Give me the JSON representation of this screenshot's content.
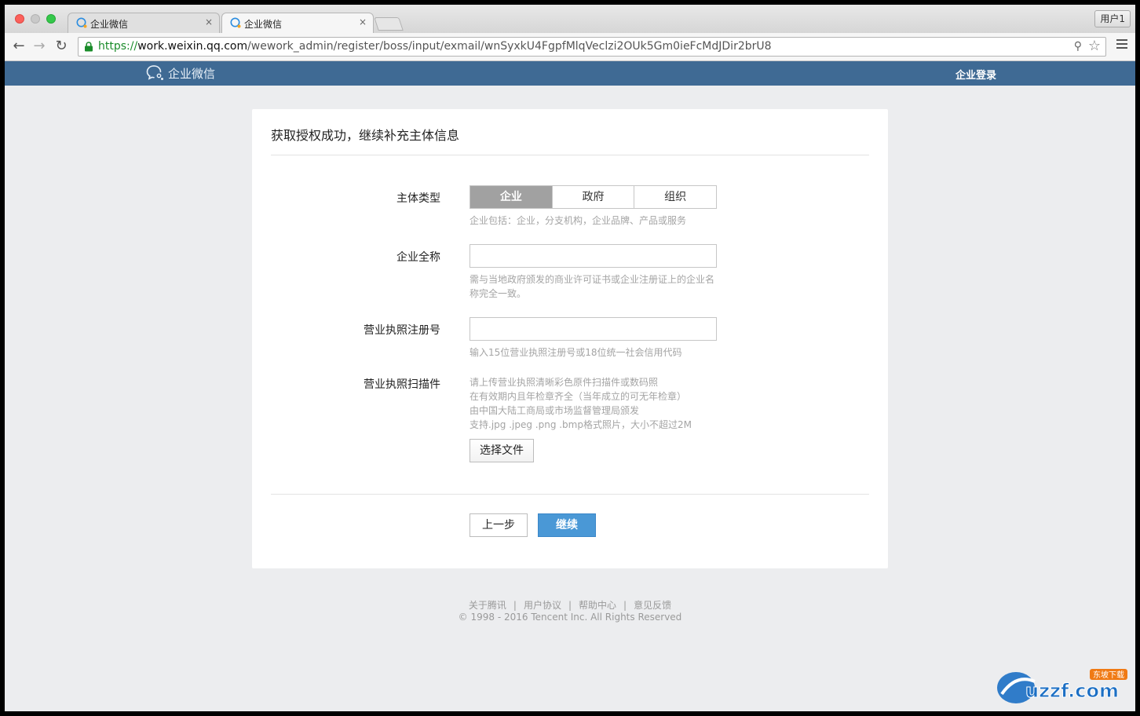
{
  "browser": {
    "tabs": [
      {
        "title": "企业微信",
        "close": "×"
      },
      {
        "title": "企业微信",
        "close": "×"
      }
    ],
    "profile_button": "用户1",
    "url": {
      "scheme": "https://",
      "host": "work.weixin.qq.com",
      "path": "/wework_admin/register/boss/input/exmail/wnSyxkU4FgpfMlqVeclzi2OUk5Gm0ieFcMdJDir2brU8"
    },
    "icons": {
      "back": "arrow-left-icon",
      "forward": "arrow-right-icon",
      "reload": "reload-icon",
      "lock": "lock-icon",
      "key": "key-icon",
      "star": "star-icon",
      "menu": "hamburger-menu-icon"
    }
  },
  "header": {
    "logo_text": "企业微信",
    "login_link": "企业登录",
    "bg_color": "#3f6a94"
  },
  "form": {
    "title": "获取授权成功，继续补充主体信息",
    "entity_type": {
      "label": "主体类型",
      "options": [
        "企业",
        "政府",
        "组织"
      ],
      "selected": "企业",
      "hint": "企业包括：企业，分支机构，企业品牌、产品或服务"
    },
    "full_name": {
      "label": "企业全称",
      "value": "",
      "hint": "需与当地政府颁发的商业许可证书或企业注册证上的企业名称完全一致。"
    },
    "license_number": {
      "label": "营业执照注册号",
      "value": "",
      "hint": "输入15位营业执照注册号或18位统一社会信用代码"
    },
    "license_scan": {
      "label": "营业执照扫描件",
      "hints": [
        "请上传营业执照清晰彩色原件扫描件或数码照",
        "在有效期内且年检章齐全（当年成立的可无年检章）",
        "由中国大陆工商局或市场监督管理局颁发",
        "支持.jpg .jpeg .png .bmp格式照片，大小不超过2M"
      ],
      "button": "选择文件"
    },
    "prev_button": "上一步",
    "next_button": "继续",
    "accent_color": "#4a98d6"
  },
  "footer": {
    "links": [
      "关于腾讯",
      "用户协议",
      "帮助中心",
      "意见反馈"
    ],
    "separator": "|",
    "copyright": "© 1998 - 2016 Tencent Inc. All Rights Reserved"
  },
  "watermark": {
    "text": "uzzf.com",
    "badge": "东坡下载"
  }
}
